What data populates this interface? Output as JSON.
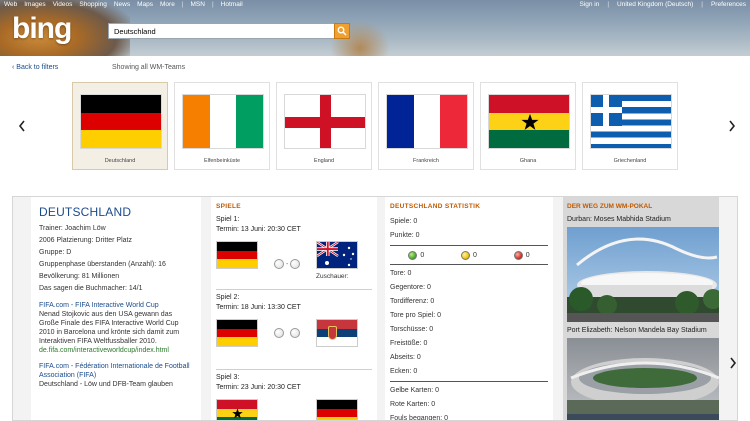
{
  "header": {
    "nav": [
      "Web",
      "Images",
      "Videos",
      "Shopping",
      "News",
      "Maps",
      "More",
      "MSN",
      "Hotmail"
    ],
    "right": [
      "Sign in",
      "United Kingdom (Deutsch)",
      "Preferences"
    ],
    "logo": "bing",
    "search_value": "Deutschland"
  },
  "filters": {
    "back_label": "‹ Back to filters",
    "showing_label": "Showing all WM-Teams",
    "teams": [
      "Deutschland",
      "Elfenbeinküste",
      "England",
      "Frankreich",
      "Ghana",
      "Griechenland"
    ],
    "selected": "Deutschland"
  },
  "team_info": {
    "name": "DEUTSCHLAND",
    "lines": [
      "Trainer: Joachim Löw",
      "2006 Platzierung: Dritter Platz",
      "Gruppe: D",
      "Gruppenphase überstanden (Anzahl): 16",
      "Bevölkerung: 81 Millionen",
      "Das sagen die Buchmacher: 14/1"
    ],
    "news": [
      {
        "title": "FIFA.com - FIFA Interactive World Cup",
        "body": "Nenad Stojkovic aus den USA gewann das Große Finale des FIFA Interactive World Cup 2010 in Barcelona und krönte sich damit zum Interaktiven FIFA Weltfussballer 2010.",
        "url": "de.fifa.com/interactiveworldcup/index.html"
      },
      {
        "title": "FIFA.com - Fédération Internationale de Football Association (FIFA)",
        "body": "Deutschland - Löw und DFB-Team glauben"
      }
    ]
  },
  "games": {
    "title": "SPIELE",
    "items": [
      {
        "label": "Spiel 1:",
        "termin": "Termin: 13 Juni: 20:30 CET",
        "zuschauer": "Zuschauer:",
        "home": "Deutschland",
        "away": "Australien"
      },
      {
        "label": "Spiel 2:",
        "termin": "Termin: 18 Juni: 13:30 CET",
        "home": "Deutschland",
        "away": "Serbien"
      },
      {
        "label": "Spiel 3:",
        "termin": "Termin: 23 Juni: 20:30 CET",
        "home": "Ghana",
        "away": "Deutschland"
      }
    ]
  },
  "stats": {
    "title": "DEUTSCHLAND STATISTIK",
    "top": [
      "Spiele: 0",
      "Punkte: 0"
    ],
    "dots": [
      {
        "color": "#4caf2a",
        "value": "0"
      },
      {
        "color": "#f2c21a",
        "value": "0"
      },
      {
        "color": "#d9342b",
        "value": "0"
      }
    ],
    "middle": [
      "Tore: 0",
      "Gegentore: 0",
      "Tordifferenz: 0",
      "Tore pro Spiel: 0",
      "Torschüsse: 0",
      "Freistöße: 0",
      "Abseits: 0",
      "Ecken: 0"
    ],
    "bottom": [
      "Gelbe Karten: 0",
      "Rote Karten: 0",
      "Fouls begangen: 0"
    ]
  },
  "road": {
    "title": "DER WEG ZUM WM-POKAL",
    "stadiums": [
      "Durban: Moses Mabhida Stadium",
      "Port Elizabeth: Nelson Mandela Bay Stadium"
    ]
  }
}
